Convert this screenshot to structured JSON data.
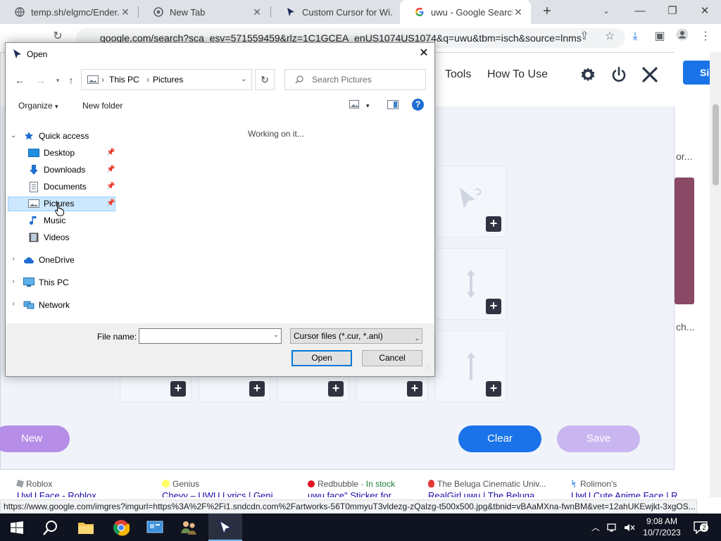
{
  "browser": {
    "tabs": [
      {
        "title": "temp.sh/elgmc/Ender..."
      },
      {
        "title": "New Tab"
      },
      {
        "title": "Custom Cursor for Wi..."
      },
      {
        "title": "uwu - Google Search"
      }
    ],
    "new_tab": "+",
    "minimize": "—",
    "maximize": "❐",
    "close": "✕",
    "omnibox_text": "google.com/search?sca_esv=571559459&rlz=1C1GCEA_enUS1074US1074&q=uwu&tbm=isch&source=lnms",
    "status_url": "https://www.google.com/imgres?imgurl=https%3A%2F%2Fi1.sndcdn.com%2Fartworks-56T0mmyuT3vldezg-zQalzg-t500x500.jpg&tbnid=vBAaMXna-fwnBM&vet=12ahUKEwjkt-3xgOS..."
  },
  "extension": {
    "nav": {
      "tools": "Tools",
      "how_to_use": "How To Use"
    },
    "blue_button": "Si",
    "buttons": {
      "new": "New",
      "clear": "Clear",
      "save": "Save"
    },
    "plus": "+",
    "side_texts": [
      "or...",
      "ch..."
    ]
  },
  "results": [
    {
      "source": "Roblox",
      "title": "UwU Face - Roblox"
    },
    {
      "source": "Genius",
      "title": "Chevy – UWU Lyrics | Geni..."
    },
    {
      "source": "Redbubble",
      "stock": "In stock",
      "title": "uwu face\" Sticker for ..."
    },
    {
      "source": "The Beluga Cinematic Univ...",
      "title": "RealGirl uwu | The Beluga ..."
    },
    {
      "source": "Rolimon's",
      "title": "UwU Cute Anime Face | R..."
    }
  ],
  "dialog": {
    "title": "Open",
    "path": {
      "this_pc": "This PC",
      "pictures": "Pictures"
    },
    "search_placeholder": "Search Pictures",
    "organize": "Organize",
    "new_folder": "New folder",
    "help": "?",
    "working": "Working on it...",
    "tree": {
      "quick_access": "Quick access",
      "desktop": "Desktop",
      "downloads": "Downloads",
      "documents": "Documents",
      "pictures": "Pictures",
      "music": "Music",
      "videos": "Videos",
      "onedrive": "OneDrive",
      "this_pc": "This PC",
      "network": "Network"
    },
    "file_name_label": "File name:",
    "file_type": "Cursor files (*.cur, *.ani)",
    "open_button": "Open",
    "cancel_button": "Cancel"
  },
  "taskbar": {
    "time": "9:08 AM",
    "date": "10/7/2023",
    "notifications": "2"
  },
  "colors": {
    "accent_blue": "#1a73e8",
    "new_button": "#b68ee8",
    "clear_button": "#1a73e8",
    "save_button": "#c9b6f0",
    "selection": "#cce8ff"
  }
}
